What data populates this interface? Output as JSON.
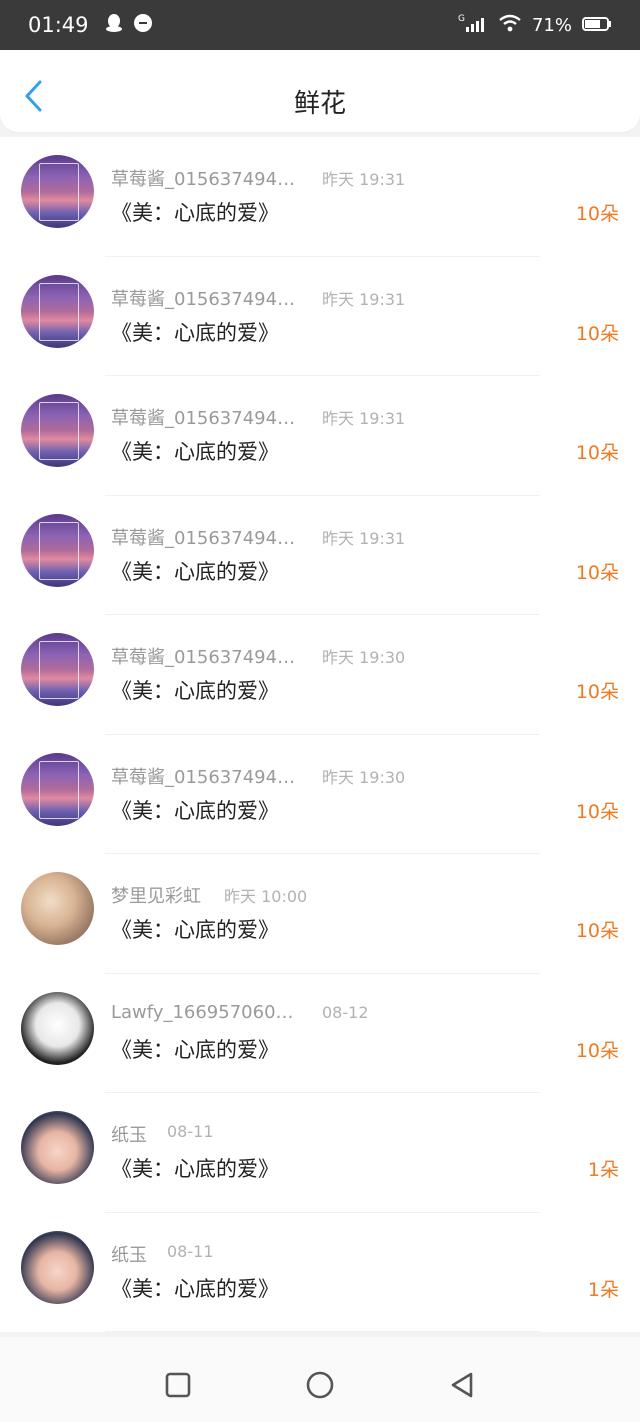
{
  "status_bar": {
    "time": "01:49",
    "network": "G",
    "battery": "71%"
  },
  "header": {
    "title": "鲜花"
  },
  "rows": [
    {
      "name": "草莓酱_015637494…",
      "time": "昨天 19:31",
      "gift": "《美：心底的爱》",
      "count": "10朵"
    },
    {
      "name": "草莓酱_015637494…",
      "time": "昨天 19:31",
      "gift": "《美：心底的爱》",
      "count": "10朵"
    },
    {
      "name": "草莓酱_015637494…",
      "time": "昨天 19:31",
      "gift": "《美：心底的爱》",
      "count": "10朵"
    },
    {
      "name": "草莓酱_015637494…",
      "time": "昨天 19:31",
      "gift": "《美：心底的爱》",
      "count": "10朵"
    },
    {
      "name": "草莓酱_015637494…",
      "time": "昨天 19:30",
      "gift": "《美：心底的爱》",
      "count": "10朵"
    },
    {
      "name": "草莓酱_015637494…",
      "time": "昨天 19:30",
      "gift": "《美：心底的爱》",
      "count": "10朵"
    },
    {
      "name": "梦里见彩虹",
      "time": "昨天 10:00",
      "gift": "《美：心底的爱》",
      "count": "10朵"
    },
    {
      "name": "Lawfy_166957060…",
      "time": "08-12",
      "gift": "《美：心底的爱》",
      "count": "10朵"
    },
    {
      "name": "纸玉",
      "time": "08-11",
      "gift": "《美：心底的爱》",
      "count": "1朵"
    },
    {
      "name": "纸玉",
      "time": "08-11",
      "gift": "《美：心底的爱》",
      "count": "1朵"
    }
  ],
  "colors": {
    "accent": "#2f9ff0",
    "count": "#f07a24"
  }
}
